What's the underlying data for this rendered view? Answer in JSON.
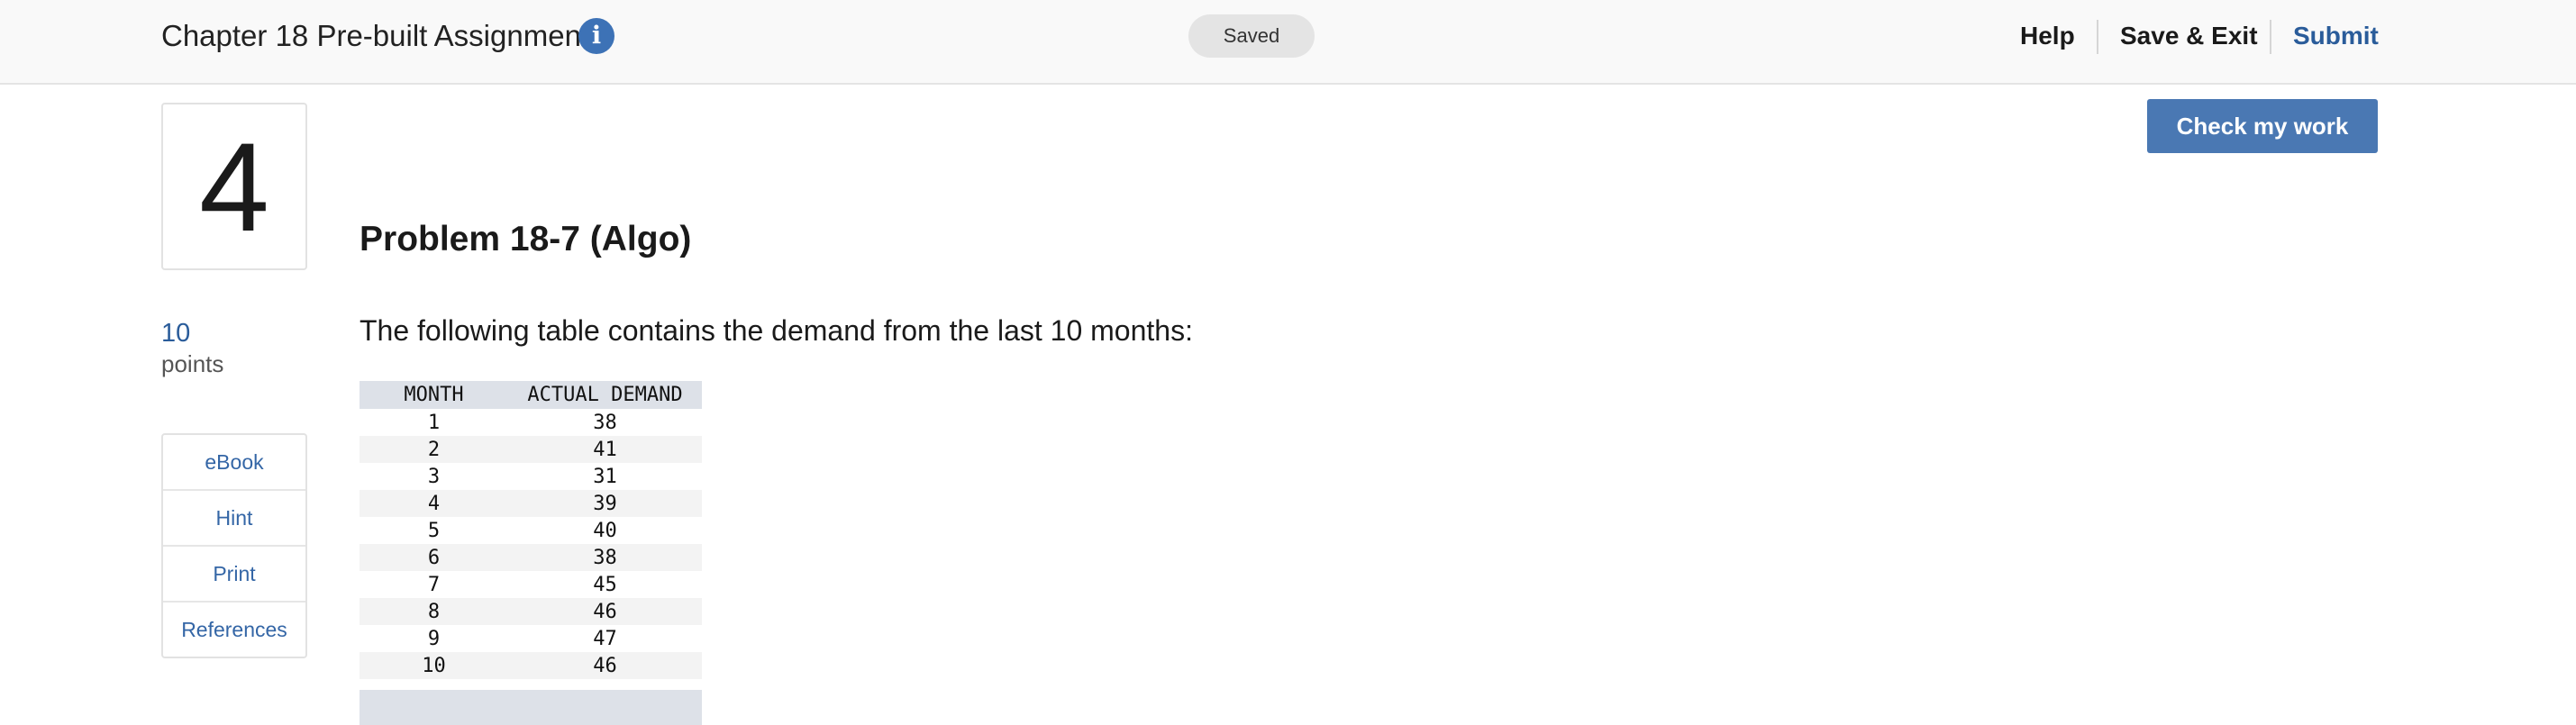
{
  "header": {
    "assignment_title": "Chapter 18 Pre-built Assignment",
    "info_icon": "i",
    "saved_status": "Saved",
    "nav": {
      "help": "Help",
      "save_exit": "Save & Exit",
      "submit": "Submit"
    }
  },
  "check_work_label": "Check my work",
  "question": {
    "number": "4",
    "points_value": "10",
    "points_label": "points"
  },
  "side_tools": [
    "eBook",
    "Hint",
    "Print",
    "References"
  ],
  "problem": {
    "title": "Problem 18-7 (Algo)",
    "intro": "The following table contains the demand from the last 10 months:",
    "table": {
      "headers": [
        "MONTH",
        "ACTUAL DEMAND"
      ],
      "rows": [
        [
          "1",
          "38"
        ],
        [
          "2",
          "41"
        ],
        [
          "3",
          "31"
        ],
        [
          "4",
          "39"
        ],
        [
          "5",
          "40"
        ],
        [
          "6",
          "38"
        ],
        [
          "7",
          "45"
        ],
        [
          "8",
          "46"
        ],
        [
          "9",
          "47"
        ],
        [
          "10",
          "46"
        ]
      ]
    }
  },
  "colors": {
    "accent": "#3d72b6",
    "button": "#4a78b3",
    "link": "#2a5c9a",
    "table_header": "#dde1e8"
  }
}
